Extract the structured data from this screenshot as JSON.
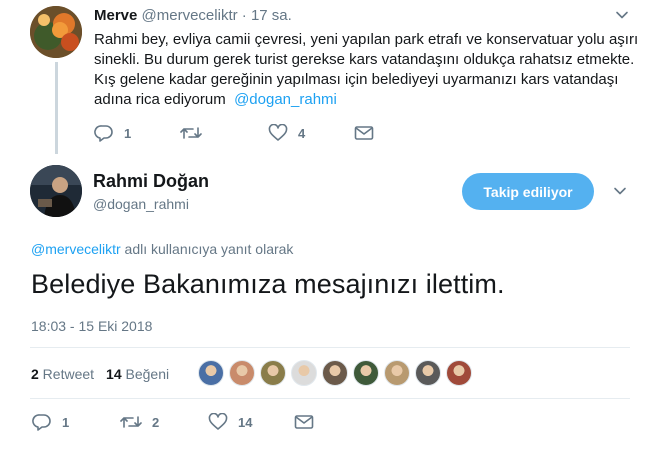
{
  "reply_tweet": {
    "author_name": "Merve",
    "author_handle": "@merveceliktr",
    "separator": "·",
    "time": "17 sa.",
    "text_lines": [
      "Rahmi bey, evliya camii çevresi, yeni yapılan park etrafı ve konservatuar yolu aşırı",
      "sinekli. Bu durum gerek turist gerekse kars vatandaşını oldukça rahatsız etmekte.",
      "Kış gelene kadar gereğinin yapılması için belediyeyi uyarmanızı kars vatandaşı",
      "adına rica ediyorum"
    ],
    "mention": "@dogan_rahmi",
    "actions": {
      "reply_count": "1",
      "retweet_count": "",
      "like_count": "4"
    }
  },
  "main_tweet": {
    "author_name": "Rahmi Doğan",
    "author_handle": "@dogan_rahmi",
    "follow_button_label": "Takip ediliyor",
    "reply_context_handle": "@merveceliktr",
    "reply_context_text": " adlı kullanıcıya yanıt olarak",
    "text": "Belediye Bakanımıza mesajınızı ilettim.",
    "timestamp": "18:03 - 15 Eki 2018",
    "stats": {
      "retweets_number": "2",
      "retweets_label": " Retweet",
      "likes_number": "14",
      "likes_label": " Beğeni"
    },
    "liker_colors": [
      "#4a6fa5",
      "#c98b6b",
      "#8a7d4a",
      "#dcdcdc",
      "#6b5a4a",
      "#3f5a3a",
      "#b89a70",
      "#5a5a5a",
      "#a04a3a"
    ],
    "actions": {
      "reply_count": "1",
      "retweet_count": "2",
      "like_count": "14"
    }
  },
  "colors": {
    "accent": "#1da1f2",
    "follow_button": "#54b1f0",
    "muted": "#657786",
    "text": "#14171a"
  },
  "icons": [
    "chevron-down-icon",
    "reply-icon",
    "retweet-icon",
    "like-icon",
    "message-icon"
  ]
}
